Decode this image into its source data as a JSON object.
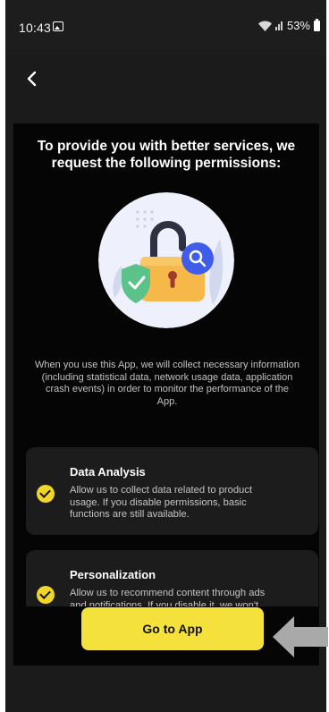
{
  "status_bar": {
    "time": "10:43",
    "battery": "53%"
  },
  "navigation": {
    "back_icon": "chevron-left-icon"
  },
  "dialog": {
    "title": "To provide you with better services, we request the following permissions:",
    "description": "When you use this App, we will collect necessary information (including statistical data, network usage data, application crash events) in order to monitor the performance of the App.",
    "permissions": [
      {
        "title": "Data Analysis",
        "text": "Allow us to collect data related to product usage. If you disable permissions, basic functions are still available."
      },
      {
        "title": "Personalization",
        "text": "Allow us to recommend content through ads and notifications. If you disable it, we won't send"
      }
    ],
    "cta_label": "Go to App"
  },
  "colors": {
    "accent": "#f4e13c",
    "background": "#050505",
    "card": "#1c1c1c"
  }
}
